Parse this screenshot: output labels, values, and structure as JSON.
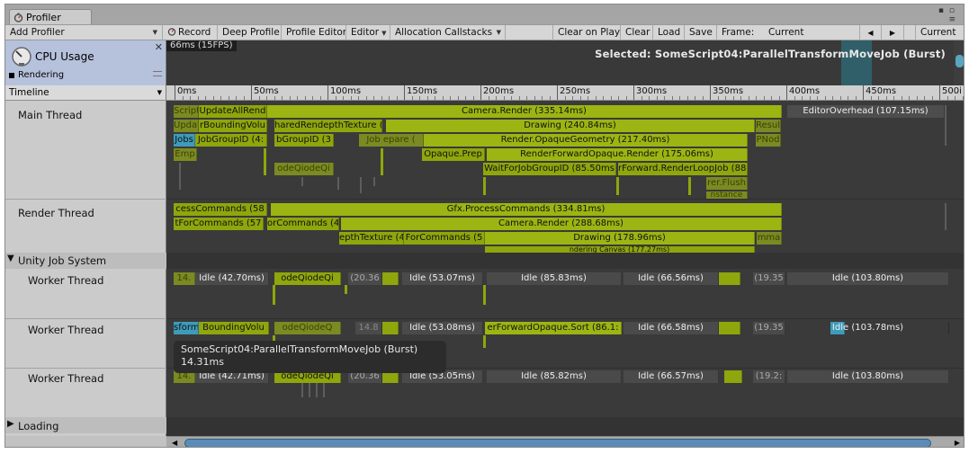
{
  "window": {
    "tab_label": "Profiler",
    "menu_icon": "kebab-menu-icon",
    "close_icon": "window-close-icon"
  },
  "toolbar": {
    "add_profiler": "Add Profiler",
    "record": "Record",
    "deep_profile": "Deep Profile",
    "profiler_editor": "Profile Editor",
    "editor": "Editor",
    "allocation_callstacks": "Allocation Callstacks",
    "clear_on_play": "Clear on Play",
    "clear": "Clear",
    "load": "Load",
    "save": "Save",
    "frame_label": "Frame:",
    "frame_value": "Current",
    "prev_icon": "◀",
    "next_icon": "▶",
    "current_button": "Current"
  },
  "module": {
    "title": "CPU Usage",
    "legend_label": "Rendering",
    "legend_color": "#000000"
  },
  "chart": {
    "scale_label": "66ms (15FPS)",
    "selected": "Selected: SomeScript04:ParallelTransformMoveJob (Burst)"
  },
  "timeline": {
    "view_label": "Timeline",
    "ruler": [
      "0ms",
      "50ms",
      "100ms",
      "150ms",
      "200ms",
      "250ms",
      "300ms",
      "350ms",
      "400ms",
      "450ms",
      "500i"
    ],
    "tracks": {
      "main": "Main Thread",
      "render": "Render Thread",
      "jobs_group": "Unity Job System",
      "worker1": "Worker Thread",
      "worker2": "Worker Thread",
      "worker3": "Worker Thread",
      "loading": "Loading"
    },
    "main_rows": {
      "r0": [
        "ScriptRunB",
        "UpdateAllRend",
        "Camera.Render (335.14ms)",
        "EditorOverhead (107.15ms)"
      ],
      "r1": [
        "UpdateRend",
        "rBoundingVolu",
        "haredRendepthTexture (",
        "Drawing (240.84ms)",
        "Result"
      ],
      "r2": [
        "Jobs",
        "JobGroupID (4:",
        "bGroupID (3",
        "Job epare (",
        "Render.OpaqueGeometry (217.40ms)",
        "PNod"
      ],
      "r3": [
        "Emp",
        "Opaque.Prep",
        "RenderForwardOpaque.Render (175.06ms)"
      ],
      "r4": [
        "odeQiodeQi",
        "WaitForJobGroupID (85.50ms",
        "rForward.RenderLoopJob (88.!"
      ],
      "r5": [
        "rer.Flush"
      ],
      "r6": [
        "nstance"
      ]
    },
    "render_rows": {
      "r0": [
        "cessCommands (58",
        "Gfx.ProcessCommands (334.81ms)"
      ],
      "r1": [
        "tForCommands (57",
        "orCommands (4",
        "Camera.Render (288.68ms)"
      ],
      "r2": [
        "epthTexture (4",
        "ForCommands (5",
        "Drawing (178.96ms)",
        "mma"
      ],
      "r3": [
        "ndering Canvas (177.27ms)"
      ]
    },
    "worker1": [
      "14.",
      "Idle (42.70ms)",
      "odeQiodeQi",
      "(20.36",
      "Idle (53.07ms)",
      "Idle (85.83ms)",
      "Idle (66.56ms)",
      "(19.35",
      "Idle (103.80ms)"
    ],
    "worker2": [
      "sformr",
      "BoundingVolu",
      "odeQiodeQ",
      "14.8",
      "Idle (53.08ms)",
      "erForwardOpaque.Sort (86.1:",
      "Idle (66.58ms)",
      "(19.35",
      "Idle (103.78ms)"
    ],
    "worker3": [
      "14.",
      "Idle (42.71ms)",
      "odeQiodeQi",
      "(20.36",
      "Idle (53.05ms)",
      "Idle (85.82ms)",
      "Idle (66.57ms)",
      "(19.2:",
      "Idle (103.80ms)"
    ],
    "tooltip": {
      "line1": "SomeScript04:ParallelTransformMoveJob (Burst)",
      "line2": "14.31ms"
    }
  },
  "colors": {
    "job_green": "#8fa60c",
    "selected_blue": "#3e9bbb",
    "idle": "#4a4a4a",
    "module_bg": "#b6c2dc"
  }
}
